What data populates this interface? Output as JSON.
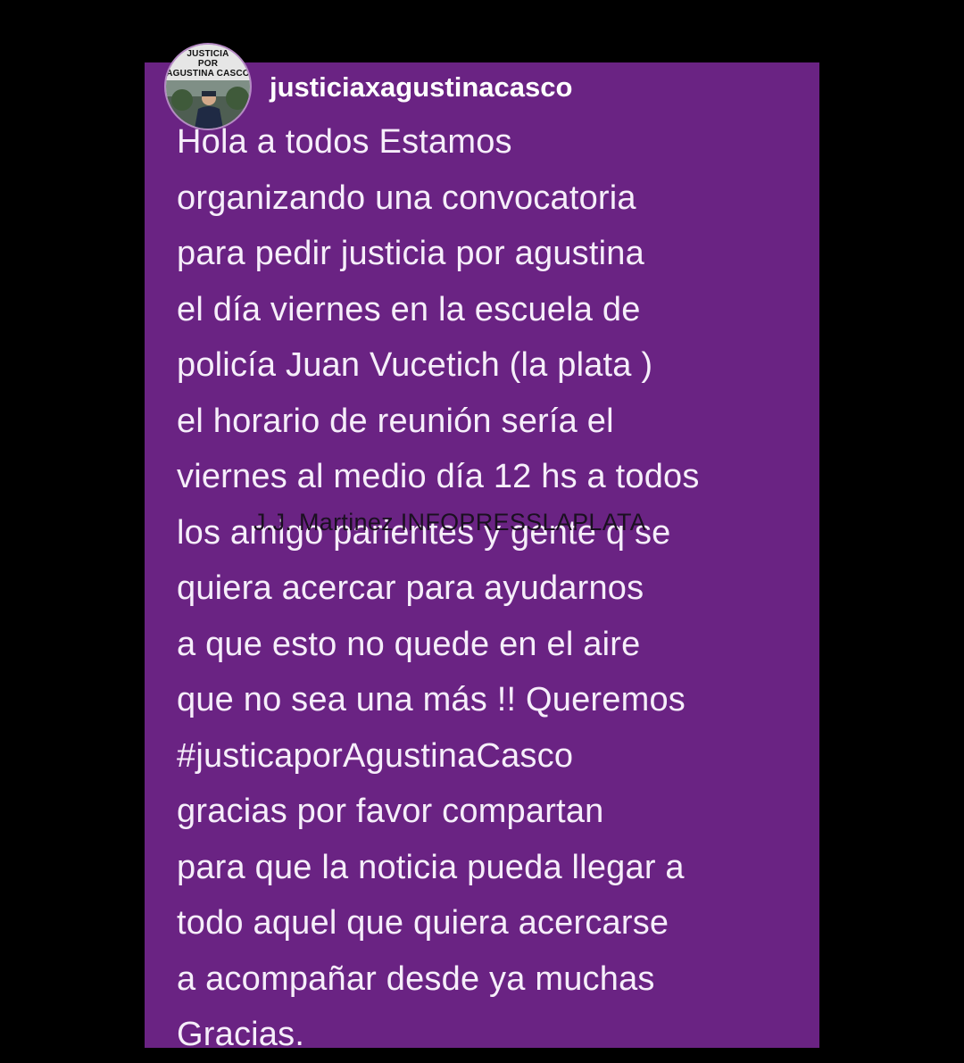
{
  "profile": {
    "avatar_text": [
      "JUSTICIA",
      "POR",
      "AGUSTINA CASCO"
    ],
    "username": "justiciaxagustinacasco"
  },
  "post": {
    "lines": [
      "Hola a todos Estamos",
      "organizando una convocatoria",
      "para pedir justicia por agustina",
      "el día viernes en la escuela de",
      "policía Juan Vucetich (la plata )",
      "el horario de reunión sería el",
      "viernes al medio día 12 hs a todos",
      "los amigo parientes y gente q se",
      "quiera acercar para ayudarnos",
      "a que esto no quede en el aire",
      "que no sea una más !! Queremos",
      "#justicaporAgustinaCasco",
      "gracias por favor compartan",
      "para que la noticia pueda llegar a",
      "todo aquel que quiera acercarse",
      "a acompañar desde ya muchas",
      "Gracias."
    ]
  },
  "watermark": "J.J. Martinez INFOPRESSLAPLATA",
  "colors": {
    "background": "#000000",
    "card": "#6a2383",
    "text": "#f6eefa"
  }
}
